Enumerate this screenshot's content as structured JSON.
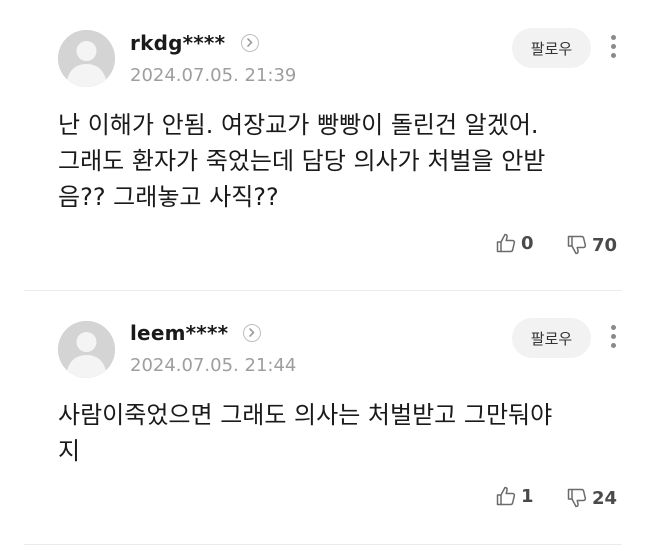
{
  "follow_label": "팔로우",
  "comments": [
    {
      "username": "rkdg****",
      "date": "2024.07.05. 21:39",
      "lines": [
        "난 이해가 안됨. 여장교가 빵빵이 돌린건 알겠어.",
        "그래도 환자가 죽었는데 담당 의사가 처벌을 안받",
        "음?? 그래놓고 사직??"
      ],
      "likes": "0",
      "dislikes": "70"
    },
    {
      "username": "leem****",
      "date": "2024.07.05. 21:44",
      "lines": [
        "사람이죽었으면 그래도 의사는 처벌받고 그만둬야",
        "지"
      ],
      "likes": "1",
      "dislikes": "24"
    }
  ]
}
